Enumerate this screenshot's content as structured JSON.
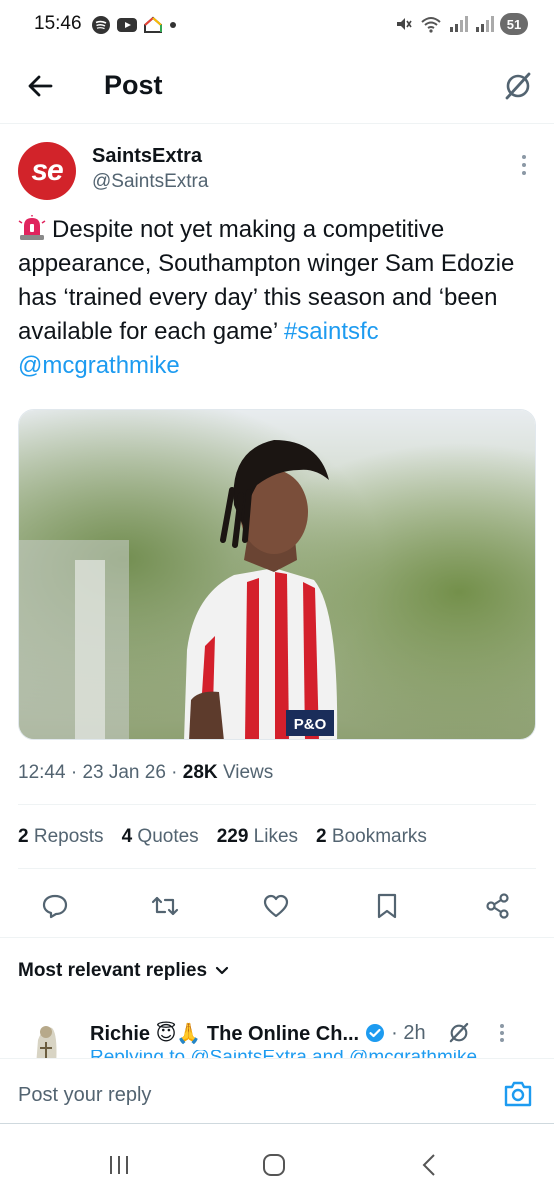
{
  "status_bar": {
    "time": "15:46",
    "battery": "51"
  },
  "header": {
    "title": "Post"
  },
  "post": {
    "author_name": "SaintsExtra",
    "author_handle": "@SaintsExtra",
    "avatar_text": "se",
    "text": "Despite not yet making a competitive appearance, Southampton winger Sam Edozie has ‘trained every day’ this season and ‘been available for each game’",
    "hashtag": "#saintsfc",
    "mention": "@mcgrathmike",
    "time": "12:44",
    "date": "23 Jan 26",
    "views_count": "28K",
    "views_label": "Views",
    "shirt_sponsor": "P&O"
  },
  "stats": {
    "reposts_count": "2",
    "reposts_label": "Reposts",
    "quotes_count": "4",
    "quotes_label": "Quotes",
    "likes_count": "229",
    "likes_label": "Likes",
    "bookmarks_count": "2",
    "bookmarks_label": "Bookmarks"
  },
  "replies": {
    "header": "Most relevant replies",
    "first_reply_name": "Richie 😇🙏 The Online Ch...",
    "first_reply_time": "· 2h",
    "first_reply_cut_text": "Replying to @SaintsExtra and @mcgrathmike"
  },
  "composer": {
    "placeholder": "Post your reply"
  },
  "colors": {
    "accent": "#1d9bf0",
    "brand_red": "#d2232a",
    "secondary_text": "#536471"
  }
}
